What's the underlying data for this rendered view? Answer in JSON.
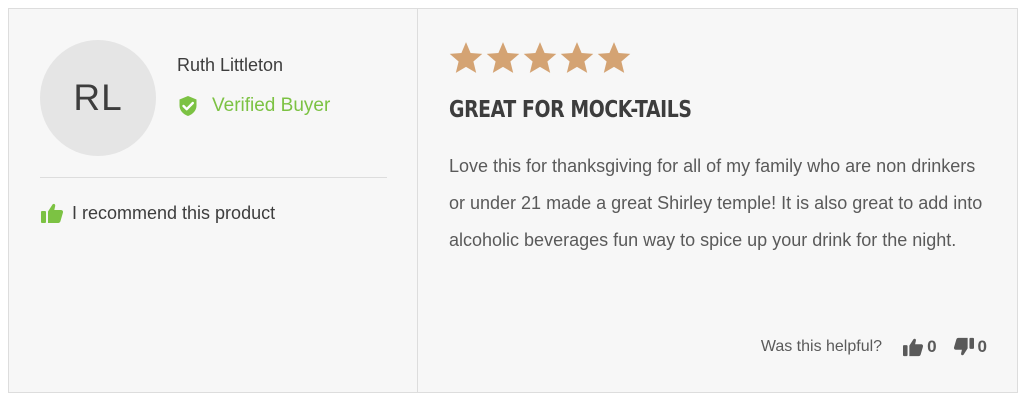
{
  "reviewer": {
    "initials": "RL",
    "name": "Ruth Littleton",
    "verified_label": "Verified Buyer"
  },
  "recommendation": {
    "text": "I recommend this product"
  },
  "review": {
    "rating": 5,
    "max_rating": 5,
    "title": "GREAT FOR MOCK-TAILS",
    "body": "Love this for thanksgiving for all of my family who are non drinkers or under 21 made a great Shirley temple! It is also great to add into alcoholic beverages fun way to spice up your drink for the night."
  },
  "helpful": {
    "label": "Was this helpful?",
    "up_count": "0",
    "down_count": "0"
  },
  "colors": {
    "star": "#d4a373",
    "verified": "#7cc243",
    "text": "#3d3d3d",
    "card_bg": "#f7f7f7"
  },
  "icons": {
    "verified": "shield-check-icon",
    "recommend": "thumbs-up-icon",
    "helpful_up": "thumbs-up-icon",
    "helpful_down": "thumbs-down-icon",
    "star": "star-icon"
  }
}
